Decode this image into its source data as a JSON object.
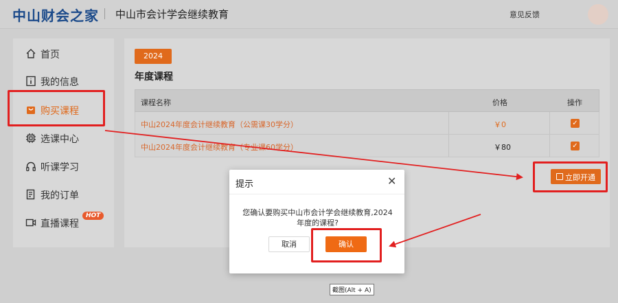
{
  "header": {
    "logo": "中山财会之家",
    "site_title": "中山市会计学会继续教育",
    "feedback": "意见反馈"
  },
  "sidebar": {
    "items": [
      {
        "label": "首页",
        "icon": "home-icon"
      },
      {
        "label": "我的信息",
        "icon": "info-icon"
      },
      {
        "label": "购买课程",
        "icon": "shopping-bag-icon",
        "active": true
      },
      {
        "label": "选课中心",
        "icon": "chip-icon"
      },
      {
        "label": "听课学习",
        "icon": "headphones-icon"
      },
      {
        "label": "我的订单",
        "icon": "order-icon"
      },
      {
        "label": "直播课程",
        "icon": "video-icon"
      }
    ],
    "hot_badge": "HOT"
  },
  "main": {
    "year_tab": "2024",
    "section_title": "年度课程",
    "table": {
      "headers": [
        "课程名称",
        "价格",
        "操作"
      ],
      "rows": [
        {
          "name": "中山2024年度会计继续教育（公需课30学分）",
          "price": "￥0",
          "checked": true
        },
        {
          "name": "中山2024年度会计继续教育（专业课60学分）",
          "price": "￥80",
          "checked": true
        }
      ]
    },
    "open_button": "立即开通"
  },
  "dialog": {
    "title": "提示",
    "message": "您确认要购买中山市会计学会继续教育,2024年度的课程?",
    "cancel": "取消",
    "confirm": "确认"
  },
  "tooltip": "截图(Alt + A)",
  "colors": {
    "accent": "#e06a1c",
    "annotation": "#e21f1f",
    "brand": "#1b4a8a"
  }
}
